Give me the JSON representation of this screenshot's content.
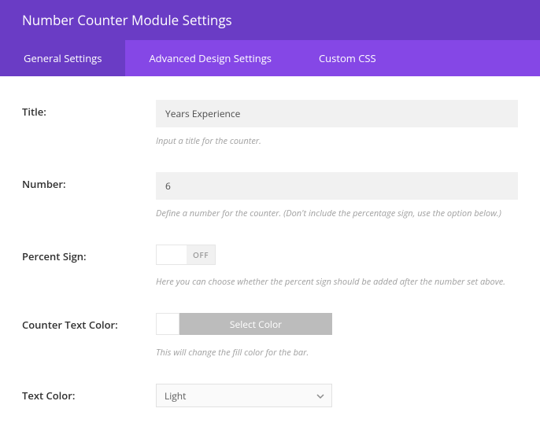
{
  "header": {
    "title": "Number Counter Module Settings"
  },
  "tabs": [
    {
      "label": "General Settings",
      "active": true
    },
    {
      "label": "Advanced Design Settings",
      "active": false
    },
    {
      "label": "Custom CSS",
      "active": false
    }
  ],
  "fields": {
    "title": {
      "label": "Title:",
      "value": "Years Experience",
      "help": "Input a title for the counter."
    },
    "number": {
      "label": "Number:",
      "value": "6",
      "help": "Define a number for the counter. (Don't include the percentage sign, use the option below.)"
    },
    "percent": {
      "label": "Percent Sign:",
      "state": "OFF",
      "help": "Here you can choose whether the percent sign should be added after the number set above."
    },
    "counter_color": {
      "label": "Counter Text Color:",
      "button": "Select Color",
      "swatch": "#ffffff",
      "help": "This will change the fill color for the bar."
    },
    "text_color": {
      "label": "Text Color:",
      "value": "Light"
    }
  }
}
